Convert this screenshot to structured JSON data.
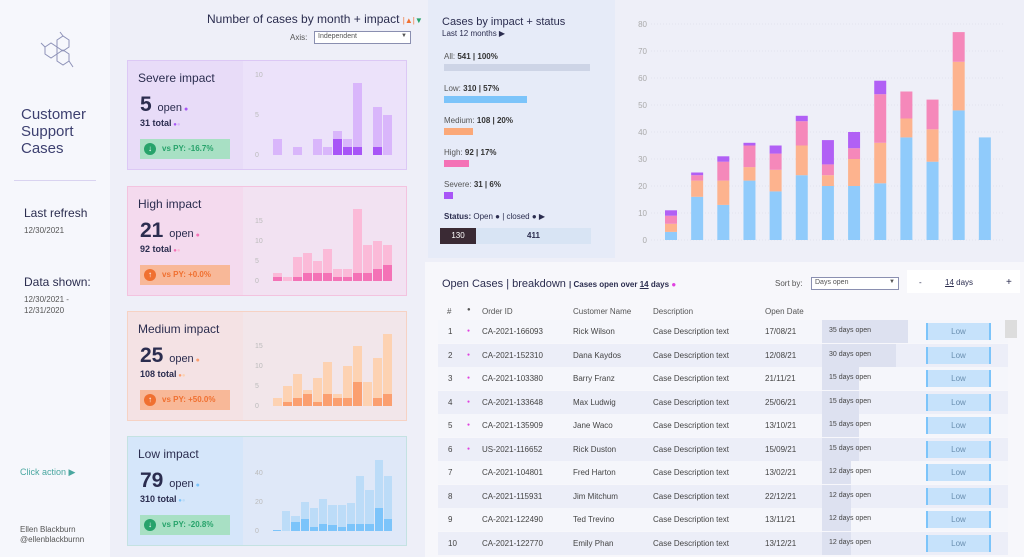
{
  "sidebar": {
    "title": "Customer Support Cases",
    "last_refresh_label": "Last refresh",
    "last_refresh": "12/30/2021",
    "data_shown_label": "Data shown:",
    "data_shown": "12/30/2021 - 12/31/2020",
    "click_action": "Click action ▶",
    "author": "Ellen Blackburn",
    "handle": "@ellenblackburnn"
  },
  "header": {
    "title": "Number of cases by month + impact",
    "axis_label": "Axis:",
    "axis_value": "Independent"
  },
  "cards": [
    {
      "title": "Severe impact",
      "open": "5",
      "open_label": "open",
      "total": "31 total",
      "py": "vs PY: -16.7%",
      "dir": "down",
      "color": "#a855f7",
      "light": "#d9b6fb",
      "bg": "#e8dcf8",
      "chartbg": "#ece2fa",
      "border": "#dcc8f5",
      "pybg": "#a8e0c4",
      "pyc": "#27a36b",
      "ymax": 10,
      "ticks": [
        "10",
        "5",
        "0"
      ],
      "total_by_month": [
        2,
        0,
        1,
        0,
        2,
        1,
        3,
        2,
        9,
        0,
        6,
        5
      ],
      "open_by_month": [
        0,
        0,
        0,
        0,
        0,
        0,
        2,
        1,
        1,
        0,
        1,
        0
      ]
    },
    {
      "title": "High impact",
      "open": "21",
      "open_label": "open",
      "total": "92 total",
      "py": "vs PY: +0.0%",
      "dir": "up",
      "color": "#f472b6",
      "light": "#fbbad8",
      "bg": "#f4daee",
      "chartbg": "#f2e2f2",
      "border": "#f3c3df",
      "pybg": "#f8b898",
      "pyc": "#f07030",
      "ymax": 20,
      "ticks": [
        "15",
        "10",
        "5",
        "0"
      ],
      "total_by_month": [
        2,
        1,
        6,
        7,
        5,
        8,
        3,
        3,
        18,
        9,
        10,
        9
      ],
      "open_by_month": [
        1,
        0,
        1,
        2,
        2,
        2,
        1,
        1,
        2,
        2,
        3,
        4
      ]
    },
    {
      "title": "Medium impact",
      "open": "25",
      "open_label": "open",
      "total": "108 total",
      "py": "vs PY: +50.0%",
      "dir": "up",
      "color": "#fb9f70",
      "light": "#fdd2b2",
      "bg": "#f4e2e4",
      "chartbg": "#f2e6ea",
      "border": "#f6d2c4",
      "pybg": "#f8b898",
      "pyc": "#f07030",
      "ymax": 20,
      "ticks": [
        "15",
        "10",
        "5",
        "0"
      ],
      "total_by_month": [
        2,
        5,
        8,
        4,
        7,
        11,
        3,
        10,
        15,
        6,
        12,
        18
      ],
      "open_by_month": [
        0,
        1,
        2,
        3,
        1,
        3,
        2,
        2,
        6,
        0,
        2,
        3
      ]
    },
    {
      "title": "Low impact",
      "open": "79",
      "open_label": "open",
      "total": "310 total",
      "py": "vs PY: -20.8%",
      "dir": "down",
      "color": "#7cc4fa",
      "light": "#bcdcf8",
      "bg": "#d5e6fa",
      "chartbg": "#dfe8f8",
      "border": "#c4e2e2",
      "pybg": "#a8e0c4",
      "pyc": "#27a36b",
      "ymax": 55,
      "ticks": [
        "40",
        "20",
        "0"
      ],
      "total_by_month": [
        1,
        14,
        10,
        20,
        16,
        22,
        18,
        18,
        19,
        38,
        28,
        49,
        38
      ],
      "open_by_month": [
        1,
        0,
        6,
        8,
        3,
        5,
        4,
        3,
        5,
        5,
        5,
        16,
        8
      ]
    }
  ],
  "status_panel": {
    "title": "Cases by impact + status",
    "subtitle": "Last 12 months ▶",
    "bars": [
      {
        "label": "All:",
        "value": "541 | 100%",
        "pct": 100,
        "color": "#cdd4e6"
      },
      {
        "label": "Low:",
        "value": "310 | 57%",
        "pct": 57,
        "color": "#7cc4fa"
      },
      {
        "label": "Medium:",
        "value": "108 | 20%",
        "pct": 20,
        "color": "#fba878"
      },
      {
        "label": "High:",
        "value": "92 | 17%",
        "pct": 17,
        "color": "#f472b6"
      },
      {
        "label": "Severe:",
        "value": "31 | 6%",
        "pct": 6,
        "color": "#a855f7"
      }
    ],
    "status_label": "Status:",
    "status_legend": "Open ● | closed ● ▶",
    "open_count": "130",
    "closed_count": "411"
  },
  "chart_data": {
    "type": "bar",
    "stacked": true,
    "ylim": [
      0,
      80
    ],
    "yticks": [
      "0",
      "10",
      "20",
      "30",
      "40",
      "50",
      "60",
      "70",
      "80"
    ],
    "grid": true,
    "series": [
      {
        "key": "low",
        "color": "#90cbfb",
        "values": [
          3,
          16,
          13,
          22,
          18,
          24,
          20,
          20,
          21,
          38,
          29,
          48,
          38
        ]
      },
      {
        "key": "medium",
        "color": "#fdb38e",
        "values": [
          3,
          6,
          9,
          5,
          8,
          11,
          4,
          10,
          15,
          7,
          12,
          18,
          0
        ]
      },
      {
        "key": "high",
        "color": "#f588ba",
        "values": [
          3,
          2,
          7,
          8,
          6,
          9,
          4,
          4,
          18,
          10,
          11,
          11,
          0
        ]
      },
      {
        "key": "severe",
        "color": "#b160f5",
        "values": [
          2,
          1,
          2,
          1,
          3,
          2,
          9,
          6,
          5,
          0,
          0,
          0,
          0
        ]
      }
    ]
  },
  "table": {
    "title": "Open Cases | breakdown",
    "subtitle_pre": "| Cases open over ",
    "subtitle_days": "14",
    "subtitle_post": " days",
    "sort_label": "Sort by:",
    "sort_value": "Days open",
    "stepper_minus": "-",
    "stepper_value": "14",
    "stepper_unit": " days",
    "stepper_plus": "+",
    "headers": [
      "#",
      "●",
      "Order ID",
      "Customer Name",
      "Description",
      "Open Date"
    ],
    "rows": [
      {
        "n": "1",
        "dot": true,
        "id": "CA-2021-166093",
        "name": "Rick Wilson",
        "desc": "Case Description text",
        "date": "17/08/21",
        "days": 35,
        "days_label": "35 days open",
        "impact": "Low"
      },
      {
        "n": "2",
        "dot": true,
        "id": "CA-2021-152310",
        "name": "Dana Kaydos",
        "desc": "Case Description text",
        "date": "12/08/21",
        "days": 30,
        "days_label": "30 days open",
        "impact": "Low"
      },
      {
        "n": "3",
        "dot": true,
        "id": "CA-2021-103380",
        "name": "Barry Franz",
        "desc": "Case Description text",
        "date": "21/11/21",
        "days": 15,
        "days_label": "15 days open",
        "impact": "Low"
      },
      {
        "n": "4",
        "dot": true,
        "id": "CA-2021-133648",
        "name": "Max Ludwig",
        "desc": "Case Description text",
        "date": "25/06/21",
        "days": 15,
        "days_label": "15 days open",
        "impact": "Low"
      },
      {
        "n": "5",
        "dot": true,
        "id": "CA-2021-135909",
        "name": "Jane Waco",
        "desc": "Case Description text",
        "date": "13/10/21",
        "days": 15,
        "days_label": "15 days open",
        "impact": "Low"
      },
      {
        "n": "6",
        "dot": true,
        "id": "US-2021-116652",
        "name": "Rick Duston",
        "desc": "Case Description text",
        "date": "15/09/21",
        "days": 15,
        "days_label": "15 days open",
        "impact": "Low"
      },
      {
        "n": "7",
        "dot": false,
        "id": "CA-2021-104801",
        "name": "Fred Harton",
        "desc": "Case Description text",
        "date": "13/02/21",
        "days": 12,
        "days_label": "12 days open",
        "impact": "Low"
      },
      {
        "n": "8",
        "dot": false,
        "id": "CA-2021-115931",
        "name": "Jim Mitchum",
        "desc": "Case Description text",
        "date": "22/12/21",
        "days": 12,
        "days_label": "12 days open",
        "impact": "Low"
      },
      {
        "n": "9",
        "dot": false,
        "id": "CA-2021-122490",
        "name": "Ted Trevino",
        "desc": "Case Description text",
        "date": "13/11/21",
        "days": 12,
        "days_label": "12 days open",
        "impact": "Low"
      },
      {
        "n": "10",
        "dot": false,
        "id": "CA-2021-122770",
        "name": "Emily Phan",
        "desc": "Case Description text",
        "date": "13/12/21",
        "days": 12,
        "days_label": "12 days open",
        "impact": "Low"
      }
    ]
  }
}
